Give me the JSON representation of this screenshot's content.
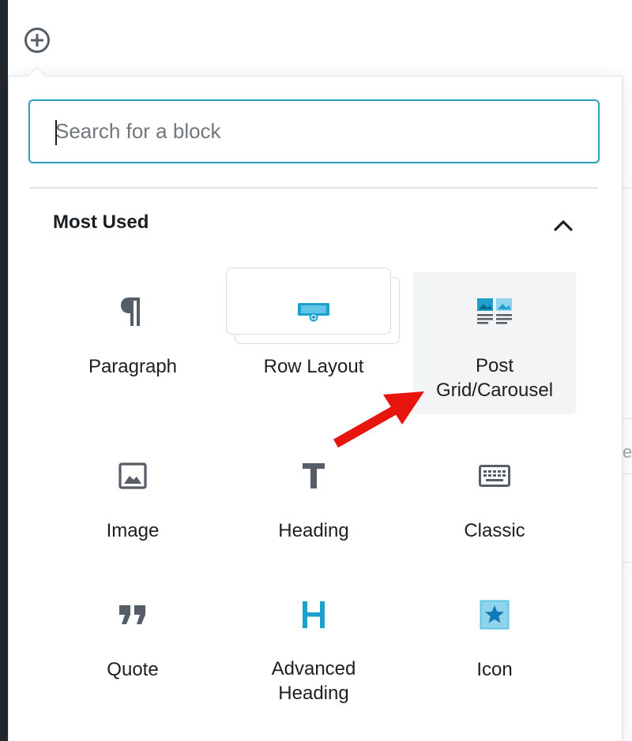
{
  "inserter": {
    "search": {
      "placeholder": "Search for a block",
      "value": ""
    },
    "panel": {
      "title": "Most Used",
      "toggle_icon": "chevron-up-icon"
    },
    "blocks": [
      {
        "label": "Paragraph",
        "icon": "paragraph-icon"
      },
      {
        "label": "Row Layout",
        "icon": "row-layout-icon"
      },
      {
        "label": "Post Grid/Carousel",
        "icon": "post-grid-icon"
      },
      {
        "label": "Image",
        "icon": "image-icon"
      },
      {
        "label": "Heading",
        "icon": "heading-icon"
      },
      {
        "label": "Classic",
        "icon": "keyboard-icon"
      },
      {
        "label": "Quote",
        "icon": "quote-icon"
      },
      {
        "label": "Advanced Heading",
        "icon": "advanced-heading-icon"
      },
      {
        "label": "Icon",
        "icon": "star-icon"
      }
    ]
  },
  "colors": {
    "accent": "#32a3be",
    "kadence_blue": "#1ea0cd",
    "icon_gray": "#555d66",
    "annotation_red": "#e8150f"
  }
}
